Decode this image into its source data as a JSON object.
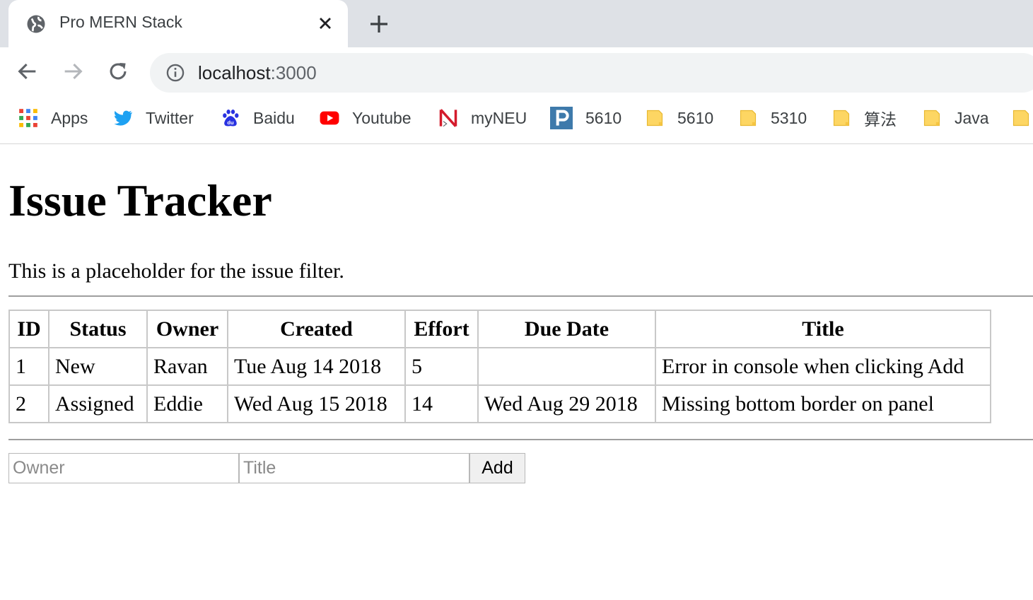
{
  "browser": {
    "tab": {
      "title": "Pro MERN Stack"
    },
    "address": {
      "host": "localhost",
      "port": ":3000"
    },
    "bookmarks": [
      {
        "label": "Apps",
        "icon": "apps-grid-icon"
      },
      {
        "label": "Twitter",
        "icon": "twitter-icon"
      },
      {
        "label": "Baidu",
        "icon": "baidu-icon"
      },
      {
        "label": "Youtube",
        "icon": "youtube-icon"
      },
      {
        "label": "myNEU",
        "icon": "myneu-icon"
      },
      {
        "label": "5610",
        "icon": "p-logo-icon"
      },
      {
        "label": "5610",
        "icon": "folder-icon"
      },
      {
        "label": "5310",
        "icon": "folder-icon"
      },
      {
        "label": "算法",
        "icon": "folder-icon"
      },
      {
        "label": "Java",
        "icon": "folder-icon"
      }
    ],
    "colors": {
      "twitter": "#1da1f2",
      "baidu": "#2932e1",
      "youtube": "#ff0000",
      "myneu": "#d41b2c",
      "folder": "#fdd663"
    }
  },
  "page": {
    "title": "Issue Tracker",
    "filter_placeholder": "This is a placeholder for the issue filter.",
    "table": {
      "headers": [
        "ID",
        "Status",
        "Owner",
        "Created",
        "Effort",
        "Due Date",
        "Title"
      ],
      "rows": [
        [
          "1",
          "New",
          "Ravan",
          "Tue Aug 14 2018",
          "5",
          "",
          "Error in console when clicking Add"
        ],
        [
          "2",
          "Assigned",
          "Eddie",
          "Wed Aug 15 2018",
          "14",
          "Wed Aug 29 2018",
          "Missing bottom border on panel"
        ]
      ]
    },
    "form": {
      "owner_placeholder": "Owner",
      "title_placeholder": "Title",
      "add_label": "Add"
    }
  }
}
